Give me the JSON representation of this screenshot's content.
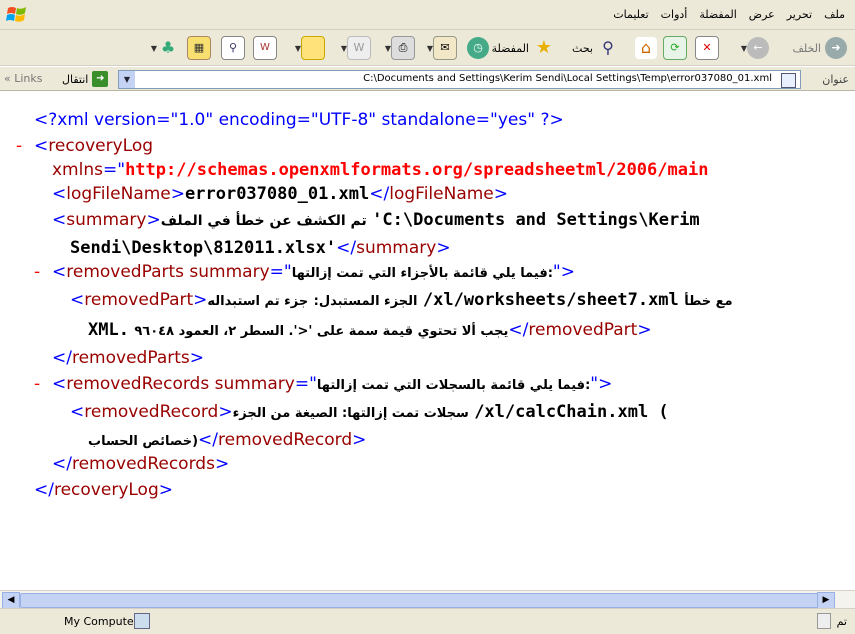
{
  "menubar": {
    "items": [
      "ملف",
      "تحرير",
      "عرض",
      "المفضلة",
      "أدوات",
      "تعليمات"
    ]
  },
  "toolbar": {
    "back_label": "الخلف",
    "search_label": "بحث",
    "favorites_label": "المفضلة"
  },
  "addressbar": {
    "label": "عنوان",
    "url": "C:\\Documents and Settings\\Kerim Sendi\\Local Settings\\Temp\\error037080_01.xml",
    "go_label": "انتقال",
    "links_label": "Links"
  },
  "xml": {
    "declaration": "<?xml version=\"1.0\" encoding=\"UTF-8\" standalone=\"yes\" ?>",
    "minus": "-",
    "recovery_open": "recoveryLog",
    "xmlns_attr": "xmlns",
    "xmlns_value": "http://schemas.openxmlformats.org/spreadsheetml/2006/main",
    "logfile_tag": "logFileName",
    "logfile_value": "error037080_01.xml",
    "summary_tag": "summary",
    "summary_text_ar": "تم الكشف عن خطأ في الملف",
    "summary_path1": "'C:\\Documents and Settings\\Kerim",
    "summary_path2": "Sendi\\Desktop\\812011.xlsx'",
    "removedParts_tag": "removedParts",
    "summary_attr": "summary",
    "removedParts_summary": "فيما يلي قائمة بالأجزاء التي تمت إزالتها:",
    "removedPart_tag": "removedPart",
    "removedPart_text_ar1": "الجزء المستبدل:",
    "removedPart_path": "/xl/worksheets/sheet7.xml",
    "removedPart_text_ar2": "جزء تم استبداله",
    "removedPart_text_ar3": "مع خطأ",
    "removedPart_line2_ar": "يجب ألا تحتوي قيمة سمة على '<'. السطر ٢، العمود ٩٦٠٤٨",
    "removedPart_line2_xml": "XML.",
    "removedRecords_tag": "removedRecords",
    "removedRecords_summary": "فيما يلي قائمة بالسجلات التي تمت إزالتها:",
    "removedRecord_tag": "removedRecord",
    "removedRecord_text_ar": "سجلات تمت إزالتها: الصيغة من الجزء",
    "removedRecord_path": "/xl/calcChain.xml (",
    "removedRecord_line2": "خصائص الحساب)"
  },
  "statusbar": {
    "zone": "My Computer",
    "done": "تم"
  }
}
